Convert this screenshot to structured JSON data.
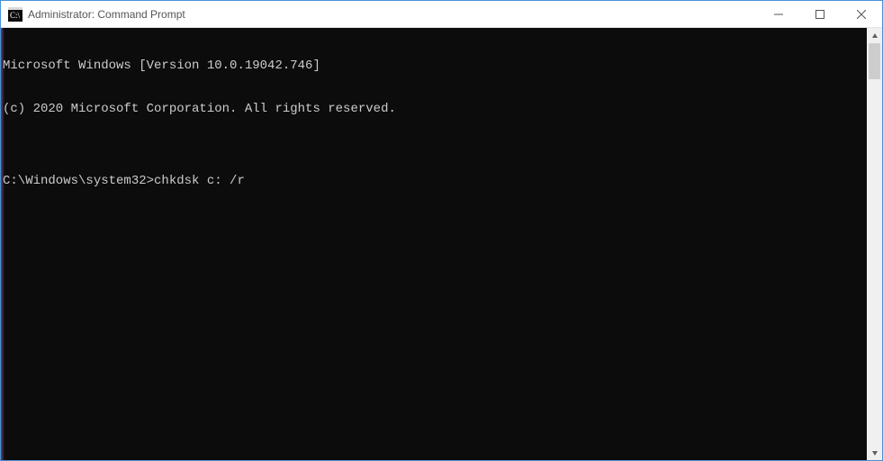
{
  "titlebar": {
    "title": "Administrator: Command Prompt"
  },
  "terminal": {
    "line1": "Microsoft Windows [Version 10.0.19042.746]",
    "line2": "(c) 2020 Microsoft Corporation. All rights reserved.",
    "blank": "",
    "prompt": "C:\\Windows\\system32>",
    "command": "chkdsk c: /r"
  }
}
